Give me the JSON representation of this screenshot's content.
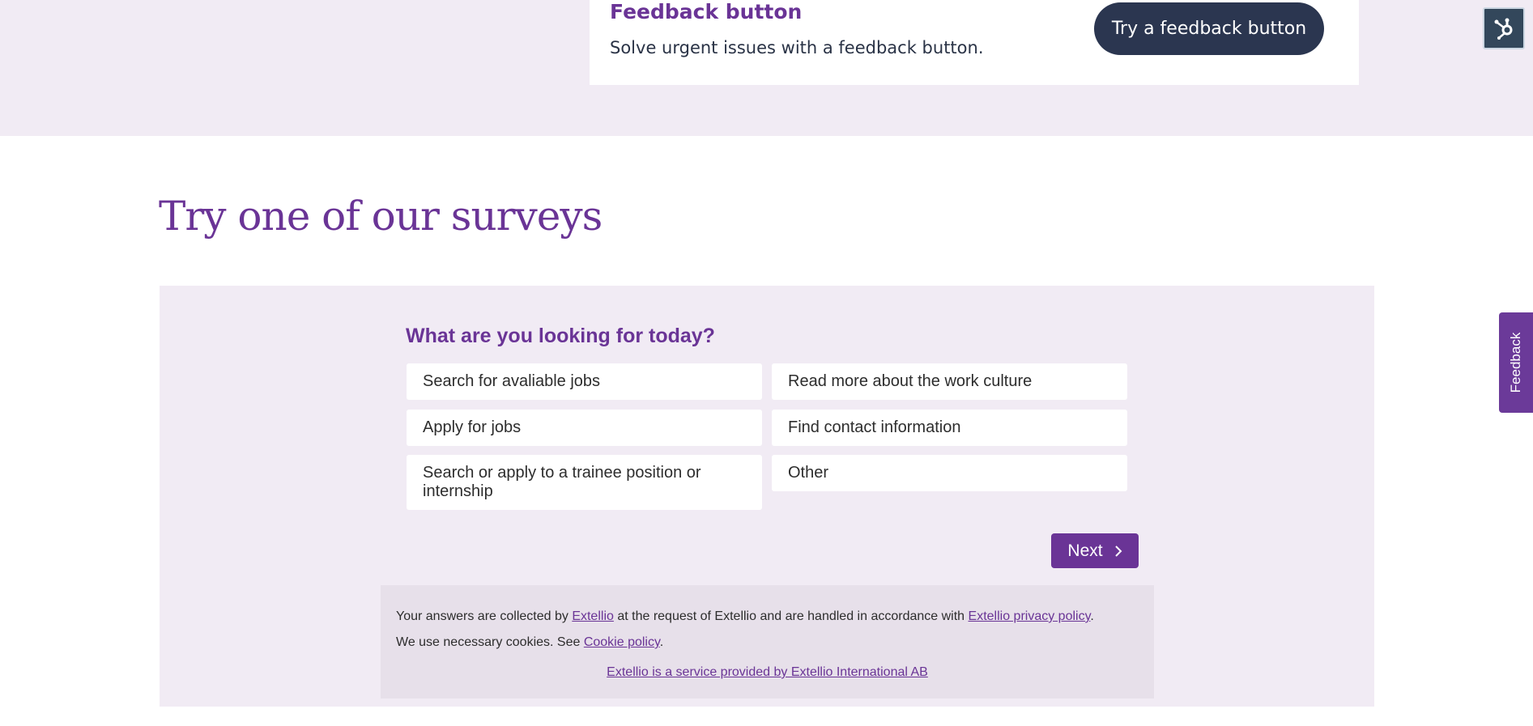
{
  "feedback_card": {
    "title": "Feedback button",
    "description": "Solve urgent issues with a feedback button.",
    "button_label": "Try a feedback button"
  },
  "side_tab": {
    "label": "Feedback"
  },
  "section": {
    "heading": "Try one of our surveys"
  },
  "survey": {
    "question": "What are you looking for today?",
    "options": [
      "Search for avaliable jobs",
      "Read more about the work culture",
      "Apply for jobs",
      "Find contact information",
      "Search or apply to a trainee position or internship",
      "Other"
    ],
    "next_label": "Next"
  },
  "footer_note": {
    "collected_prefix": "Your answers are collected by",
    "collector_link": "Extellio",
    "collected_middle": "at the request of Extellio and are handled in accordance with",
    "privacy_link": "Extellio privacy policy",
    "period": ".",
    "cookies_prefix": "We use necessary cookies. See",
    "cookie_link": "Cookie policy",
    "service_link": "Extellio is a service provided by Extellio International AB"
  },
  "icons": {
    "hub": "hubspot-sprocket-icon",
    "next": "chevron-right-icon"
  },
  "colors": {
    "accent": "#6a3496",
    "dark_button": "#2b3650",
    "band_background": "#f1ebf4",
    "note_background": "#e7e0ea"
  }
}
